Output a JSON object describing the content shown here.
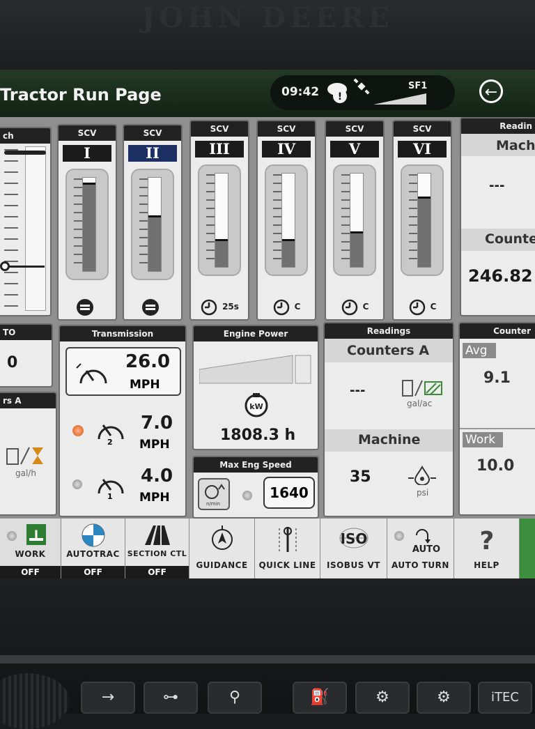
{
  "hardware": {
    "brand": "JOHN DEERE",
    "buttons": [
      "→",
      "⊶",
      "⚲",
      "⛽",
      "⚙",
      "⚙",
      "iTEC"
    ]
  },
  "header": {
    "title": "Tractor Run Page",
    "time": "09:42",
    "signal_label": "SF1",
    "back_icon": "←"
  },
  "scv": {
    "header": "SCV",
    "items": [
      {
        "numeral": "I",
        "level": 0.95,
        "bottom": ""
      },
      {
        "numeral": "II",
        "level": 0.6,
        "bottom": ""
      },
      {
        "numeral": "III",
        "level": 0.3,
        "bottom": "25s"
      },
      {
        "numeral": "IV",
        "level": 0.3,
        "bottom": "C"
      },
      {
        "numeral": "V",
        "level": 0.38,
        "bottom": "C"
      },
      {
        "numeral": "VI",
        "level": 0.75,
        "bottom": "C"
      }
    ]
  },
  "left_partial": {
    "header": "ch",
    "pto_label": "TO",
    "pto_value": "0",
    "counters_label": "rs A",
    "unit": "gal/h"
  },
  "right_partial": {
    "readings_header": "Readin",
    "machine_label": "Mach",
    "machine_value": "---",
    "counter_label": "Counte",
    "counter_value": "246.82",
    "counters_header": "Counter",
    "avg_label": "Avg",
    "avg_value": "9.1",
    "work_label": "Work",
    "work_value": "10.0"
  },
  "transmission": {
    "header": "Transmission",
    "speed1": "26.0",
    "unit": "MPH",
    "speed2": "7.0",
    "speed2_idx": "2",
    "speed3": "4.0",
    "speed3_idx": "1"
  },
  "engine_power": {
    "header": "Engine Power",
    "value": "1808.3 h",
    "icon_label": "kW"
  },
  "max_eng_speed": {
    "header": "Max Eng Speed",
    "value": "1640",
    "icon_label": "n/min"
  },
  "readings": {
    "header": "Readings",
    "counters_label": "Counters A",
    "counters_value": "---",
    "counters_unit": "gal/ac",
    "machine_label": "Machine",
    "machine_value": "35",
    "machine_unit": "psi"
  },
  "shortcuts": [
    {
      "label": "WORK",
      "state": "OFF"
    },
    {
      "label": "AUTOTRAC",
      "state": "OFF"
    },
    {
      "label": "SECTION CTL",
      "state": "OFF"
    },
    {
      "label": "GUIDANCE",
      "state": ""
    },
    {
      "label": "QUICK LINE",
      "state": ""
    },
    {
      "label": "ISOBUS VT",
      "state": "",
      "icon_text": "ISO"
    },
    {
      "label": "AUTO TURN",
      "state": "",
      "icon_text": "AUTO"
    },
    {
      "label": "HELP",
      "state": "",
      "icon_text": "?"
    }
  ]
}
